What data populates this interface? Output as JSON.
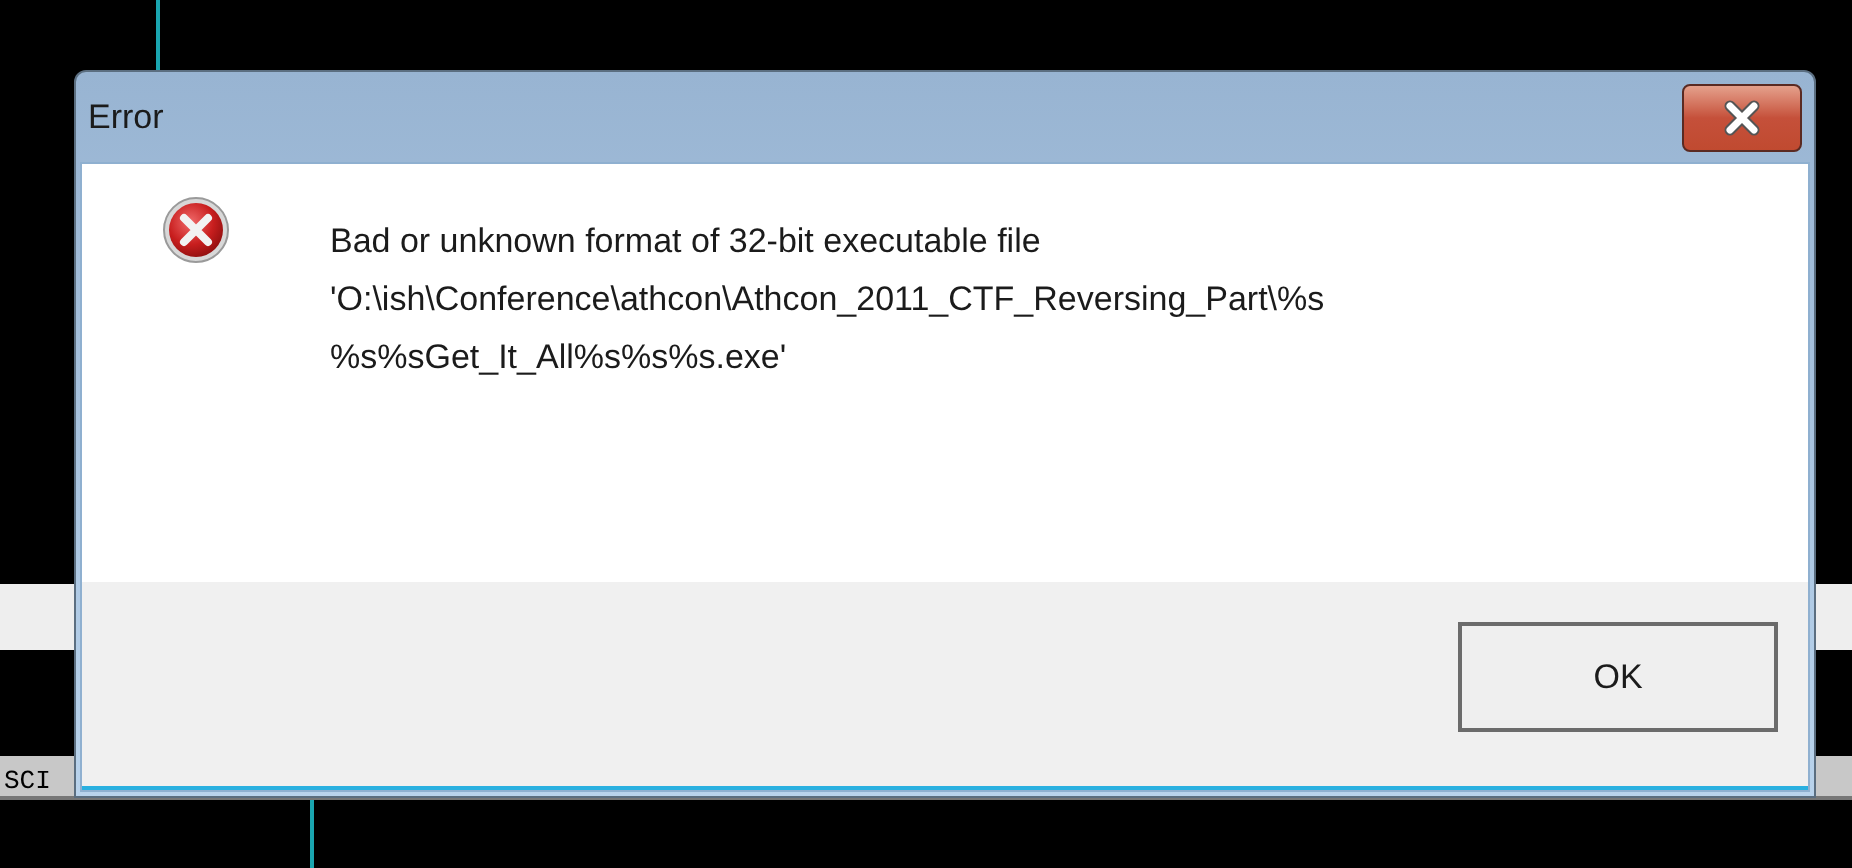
{
  "background": {
    "status_text": "SCI"
  },
  "dialog": {
    "title": "Error",
    "kind": "error",
    "message_lines": [
      "Bad or unknown format of 32-bit executable file",
      "'O:\\ish\\Conference\\athcon\\Athcon_2011_CTF_Reversing_Part\\%s",
      "%s%sGet_It_All%s%s%s.exe'"
    ],
    "buttons": [
      {
        "label": "OK",
        "default": true
      }
    ]
  }
}
